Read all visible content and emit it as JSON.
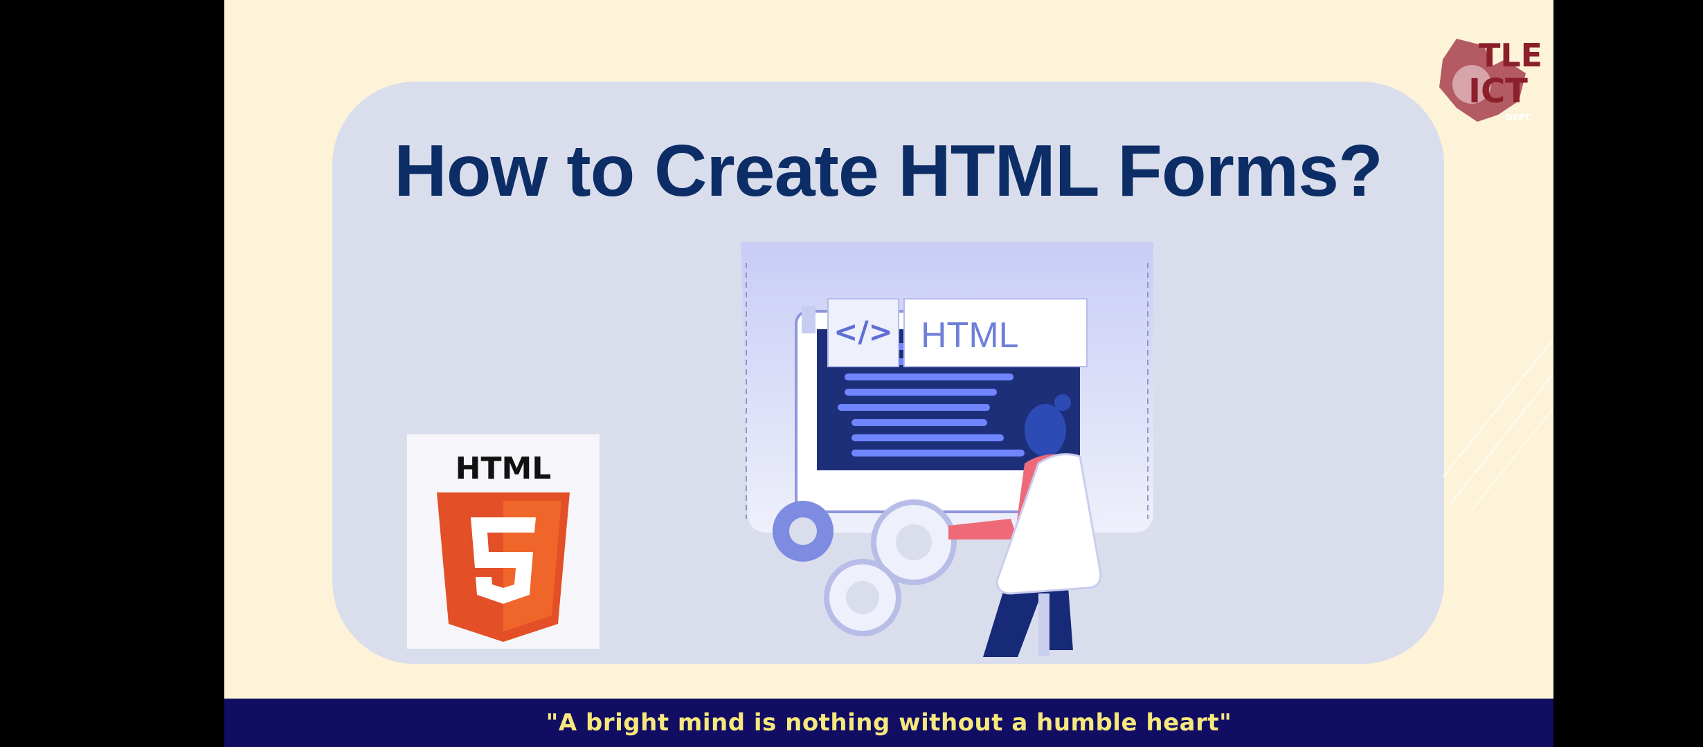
{
  "slide": {
    "title": "How to Create HTML Forms?",
    "quote": "\"A bright mind is nothing without a humble heart\""
  },
  "illustration": {
    "tag_icon_text": "</>",
    "tag_label": "HTML"
  },
  "html5_logo": {
    "label": "HTML",
    "number": "5"
  },
  "dept_logo": {
    "line1": "TLE",
    "line2": "ICT",
    "line3": "DEPT."
  },
  "colors": {
    "background": "#fdf3d8",
    "panel": "#dadeec",
    "title": "#0c2d66",
    "footer": "#100d63",
    "quote": "#f6e87c",
    "html5_orange": "#e34f26",
    "dept_maroon": "#8b1f2a"
  }
}
